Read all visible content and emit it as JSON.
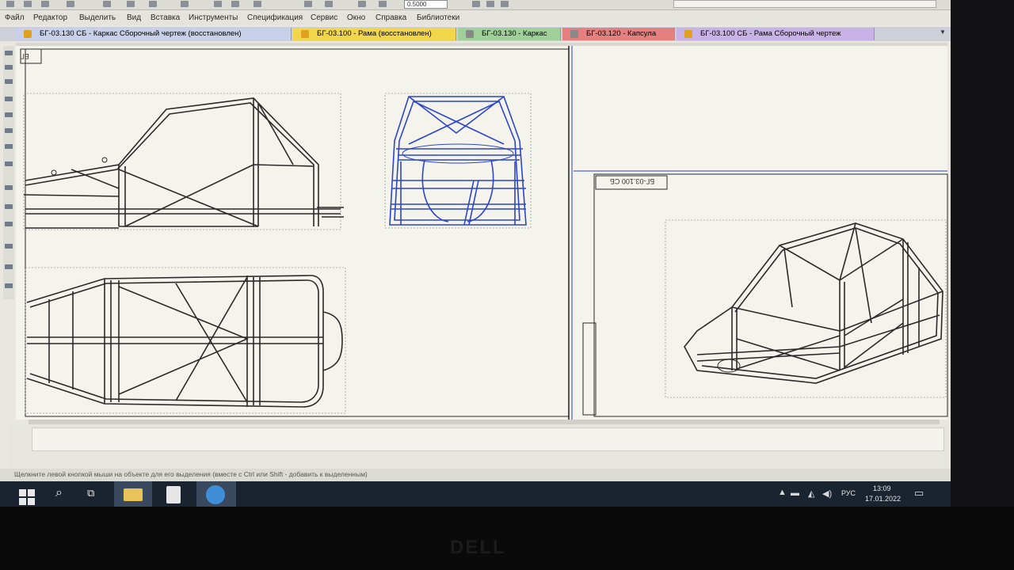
{
  "menu": [
    "Файл",
    "Редактор",
    "Выделить",
    "Вид",
    "Вставка",
    "Инструменты",
    "Спецификация",
    "Сервис",
    "Окно",
    "Справка",
    "Библиотеки"
  ],
  "tabs": [
    {
      "label": "БГ-03.130 СБ - Каркас Сборочный чертеж (восстановлен)",
      "bg": "#c7d0e8",
      "icon": "#e0a020"
    },
    {
      "label": "БГ-03.100 - Рама (восстановлен)",
      "bg": "#f1d54a",
      "icon": "#e0a020"
    },
    {
      "label": "БГ-03.130 - Каркас",
      "bg": "#9fd09a",
      "icon": "#888888"
    },
    {
      "label": "БГ-03.120 - Капсула",
      "bg": "#e68080",
      "icon": "#888888"
    },
    {
      "label": "БГ-03.100 СБ - Рама Сборочный чертеж",
      "bg": "#c9b3e6",
      "icon": "#e0a020"
    }
  ],
  "zoom": "0.5000",
  "drawing": {
    "sheet_code_tl": "БГ",
    "sheet_code_r": "БГ-03.100 СБ"
  },
  "status": "Щелкните левой кнопкой мыши на объекте для его выделения (вместе с Ctrl или Shift - добавить к выделенным)",
  "taskbar": {
    "time": "13:09",
    "date": "17.01.2022",
    "lang": "РУС"
  },
  "brand": "DELL",
  "colors": {
    "drawing_line": "#2a2a2a",
    "selected_view": "#2d46c8",
    "taskbar": "#1a2330"
  }
}
